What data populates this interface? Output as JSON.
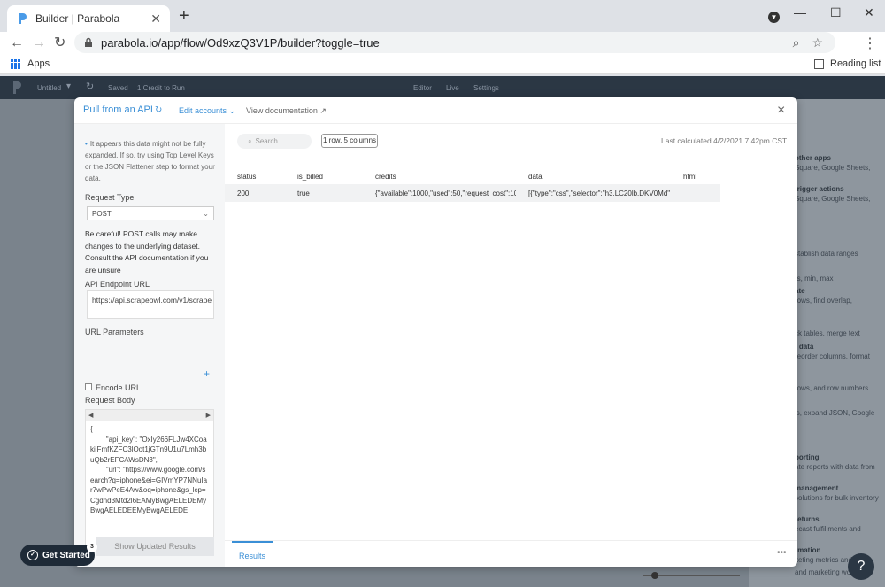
{
  "browser": {
    "tab_title": "Builder | Parabola",
    "new_tab": "+",
    "url": "parabola.io/app/flow/Od9xzQ3V1P/builder?toggle=true",
    "bookmarks_apps": "Apps",
    "reading_list": "Reading list"
  },
  "appbar": {
    "untitled": "Untitled",
    "saved": "Saved",
    "credit": "1 Credit to Run",
    "editor": "Editor",
    "live": "Live",
    "settings": "Settings"
  },
  "right_panel": [
    {
      "title": "other apps",
      "sub": "Square, Google Sheets,"
    },
    {
      "title": "trigger actions",
      "sub": "Square, Google Sheets,"
    },
    {
      "title": "",
      "sub": "stablish data ranges"
    },
    {
      "title": "",
      "sub": "rs, min, max"
    },
    {
      "title": "ate",
      "sub": "rows, find overlap,"
    },
    {
      "title": "",
      "sub": "ck tables, merge text"
    },
    {
      "title": "t data",
      "sub": "reorder columns, format"
    },
    {
      "title": "",
      "sub": "rows, and row numbers"
    },
    {
      "title": "",
      "sub": "is, expand JSON, Google"
    },
    {
      "title": "porting",
      "sub": "ate reports with data from"
    },
    {
      "title": "management",
      "sub": "solutions for bulk inventory"
    },
    {
      "title": "returns",
      "sub": "ecast fulfillments and"
    },
    {
      "title": "rmation",
      "sub": "keting metrics and"
    },
    {
      "title": "",
      "sub": "and marketing workflows"
    }
  ],
  "modal": {
    "title": "Pull from an API",
    "edit_accounts": "Edit accounts",
    "view_docs": "View documentation",
    "close": "×"
  },
  "sidebar": {
    "note": "It appears this data might not be fully expanded. If so, try using Top Level Keys or the JSON Flattener step to format your data.",
    "request_type_label": "Request Type",
    "request_type_value": "POST",
    "warning": "Be careful! POST calls may make changes to the underlying dataset. Consult the API documentation if you are unsure",
    "endpoint_label": "API Endpoint URL",
    "endpoint_value": "https://api.scrapeowl.com/v1/scrape",
    "url_params_label": "URL Parameters",
    "encode_url_label": "Encode URL",
    "request_body_label": "Request Body",
    "request_body": "{\n        \"api_key\": \"OxIy266FLJw4XCoakiiFmfKZFC3lOot1jGTn9U1u7Lmh3buQb2rEFCAWsDN3\",\n        \"url\": \"https://www.google.com/search?q=iphone&ei=GIVmYP7NNuIar7wPwPeE4Aw&oq=iphone&gs_lcp=Cgdnd3Mtd2l6EAMyBwgAELEDEMyBwgAELEDEEMyBwgAELEDE",
    "show_updated": "Show Updated Results"
  },
  "main": {
    "search_placeholder": "Search",
    "row_count": "1 row, 5 columns",
    "last_calculated": "Last calculated 4/2/2021 7:42pm CST",
    "columns": [
      "status",
      "is_billed",
      "credits",
      "data",
      "html"
    ],
    "rows": [
      [
        "200",
        "true",
        "{\"available\":1000,\"used\":50,\"request_cost\":10",
        "[{\"type\":\"css\",\"selector\":\"h3.LC20lb.DKV0Md\"",
        ""
      ]
    ],
    "results_tab": "Results",
    "more": "•••"
  },
  "overlay": {
    "get_started": "Get Started",
    "badge": "3",
    "help": "?"
  },
  "colors": {
    "accent": "#3a8fd6",
    "appbar": "#2b3744"
  }
}
